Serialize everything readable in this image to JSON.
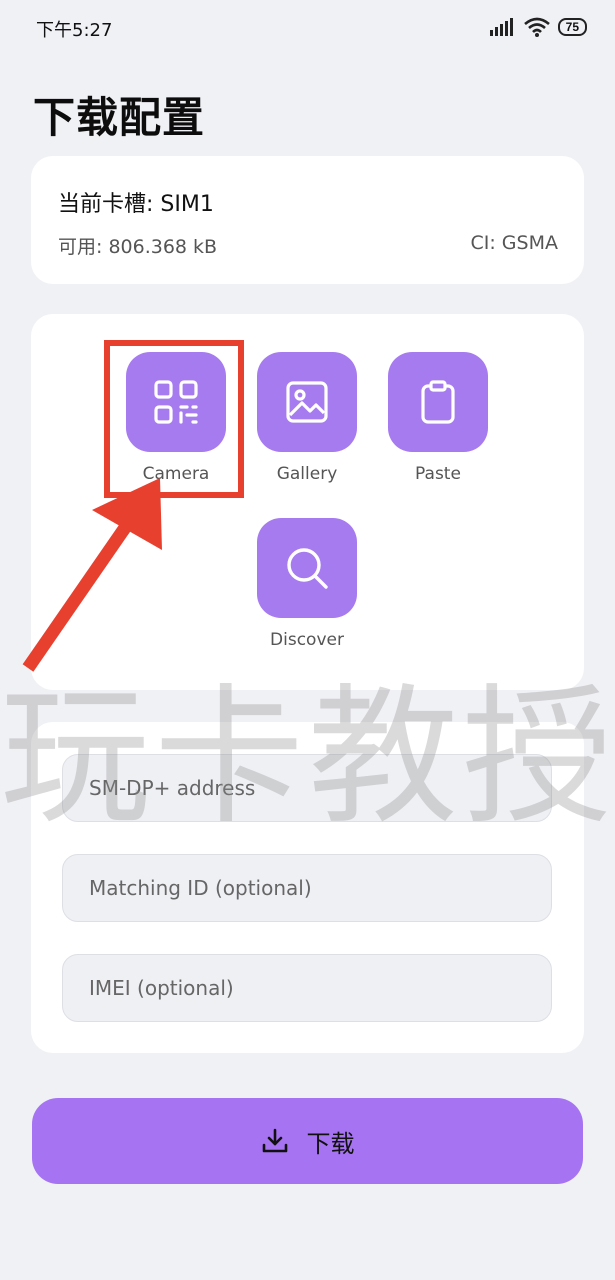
{
  "status_bar": {
    "time": "下午5:27",
    "battery": "75",
    "icons": [
      "signal-icon",
      "wifi-icon",
      "battery-icon"
    ]
  },
  "page": {
    "title": "下载配置"
  },
  "slot_card": {
    "slot_label": "当前卡槽: SIM1",
    "available_label": "可用: 806.368 kB",
    "ci_label": "CI: GSMA"
  },
  "actions": [
    {
      "label": "Camera",
      "icon": "qr-code-icon"
    },
    {
      "label": "Gallery",
      "icon": "image-icon"
    },
    {
      "label": "Paste",
      "icon": "clipboard-icon"
    },
    {
      "label": "Discover",
      "icon": "search-icon"
    }
  ],
  "fields": {
    "smdp_placeholder": "SM-DP+ address",
    "matching_id_placeholder": "Matching ID (optional)",
    "imei_placeholder": "IMEI (optional)"
  },
  "download_button": {
    "label": "下载",
    "icon": "download-icon"
  },
  "watermark": {
    "text": "玩卡教授"
  },
  "colors": {
    "background": "#f0f1f5",
    "card": "#ffffff",
    "accent": "#a77bf0",
    "button": "#a674f2",
    "annotation": "#e8402f"
  }
}
